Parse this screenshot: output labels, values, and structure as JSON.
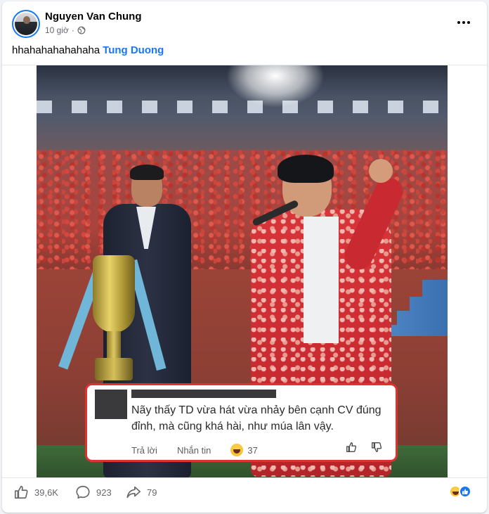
{
  "post": {
    "author": "Nguyen Van Chung",
    "time": "10 giờ",
    "caption_text": "hhahahahahahaha",
    "mention": "Tung Duong"
  },
  "comment_overlay": {
    "text": "Nãy thấy TD vừa hát vừa nhảy bên cạnh CV đúng đỉnh, mà cũng khá hài, như múa lân vậy.",
    "reply_label": "Trả lời",
    "message_label": "Nhắn tin",
    "reaction_count": "37"
  },
  "footer": {
    "like_count": "39,6K",
    "comment_count": "923",
    "share_count": "79"
  },
  "colors": {
    "brand_blue": "#1877f2",
    "highlight_red": "#e0312d"
  },
  "icons": [
    "globe-icon",
    "more-icon",
    "like-icon",
    "comment-icon",
    "share-icon",
    "haha-icon",
    "thumbs-up-icon",
    "thumbs-down-icon"
  ]
}
